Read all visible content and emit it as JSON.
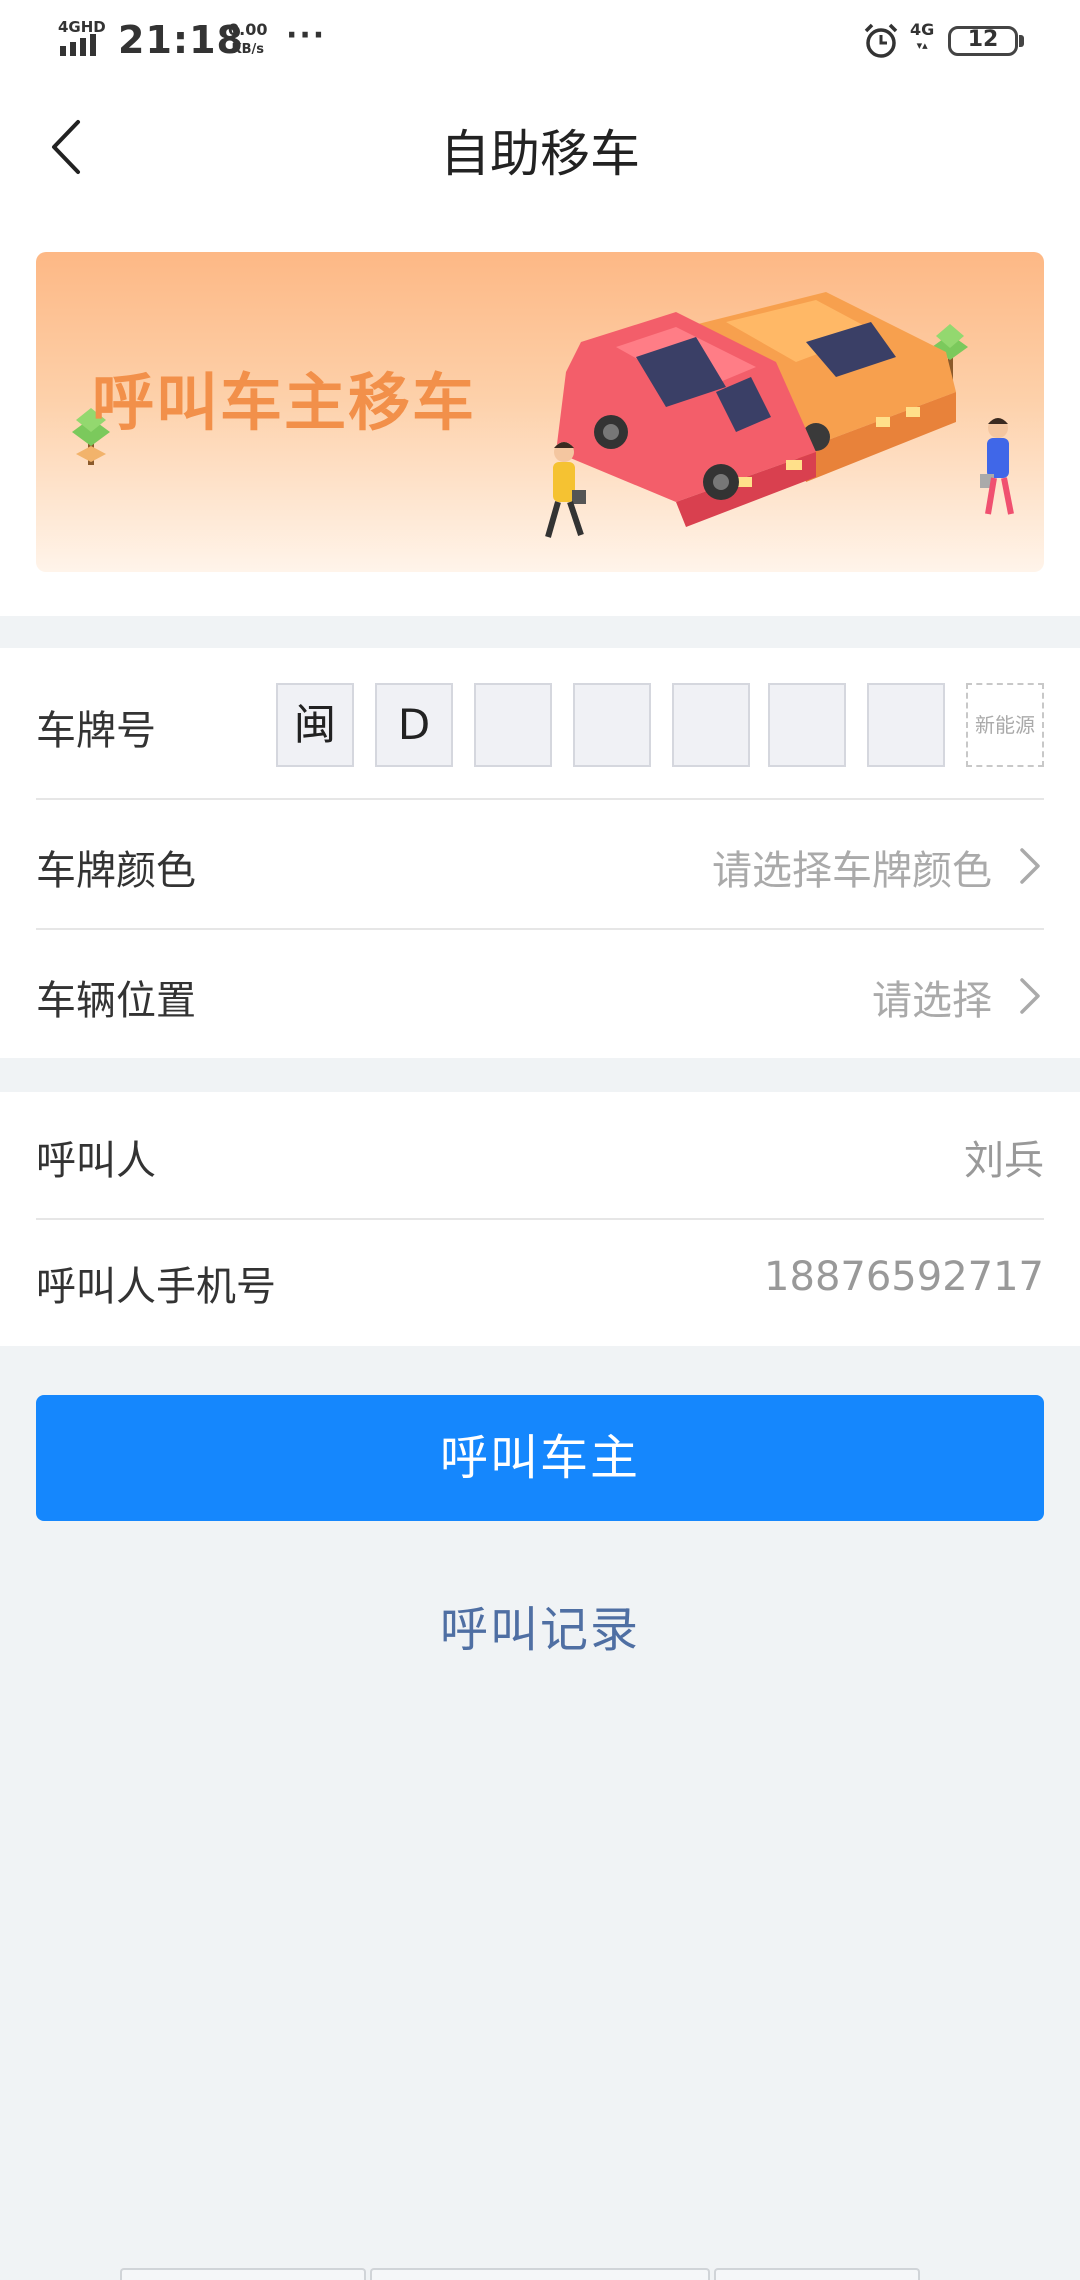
{
  "status_bar": {
    "network_type": "4GHD",
    "time": "21:18",
    "speed_value": "0.00",
    "speed_unit": "KB/s",
    "more_dots": "···",
    "mobile_data": "4G",
    "battery_level": "12",
    "icons": [
      "signal-icon",
      "alarm-icon",
      "battery-icon"
    ]
  },
  "header": {
    "title": "自助移车",
    "back_icon": "chevron-left-icon"
  },
  "banner": {
    "headline": "呼叫车主移车",
    "text_color": "#f2904a"
  },
  "plate_form": {
    "plate_label": "车牌号",
    "plate_chars": [
      "闽",
      "D",
      "",
      "",
      "",
      "",
      ""
    ],
    "new_energy_label": "新能源",
    "color_label": "车牌颜色",
    "color_placeholder": "请选择车牌颜色",
    "location_label": "车辆位置",
    "location_placeholder": "请选择"
  },
  "caller_form": {
    "caller_label": "呼叫人",
    "caller_value": "刘兵",
    "phone_label": "呼叫人手机号",
    "phone_value": "18876592717"
  },
  "actions": {
    "call_owner_label": "呼叫车主",
    "call_history_label": "呼叫记录"
  },
  "colors": {
    "primary": "#1587fd",
    "link": "#4f6fa3",
    "background": "#f0f3f5"
  }
}
